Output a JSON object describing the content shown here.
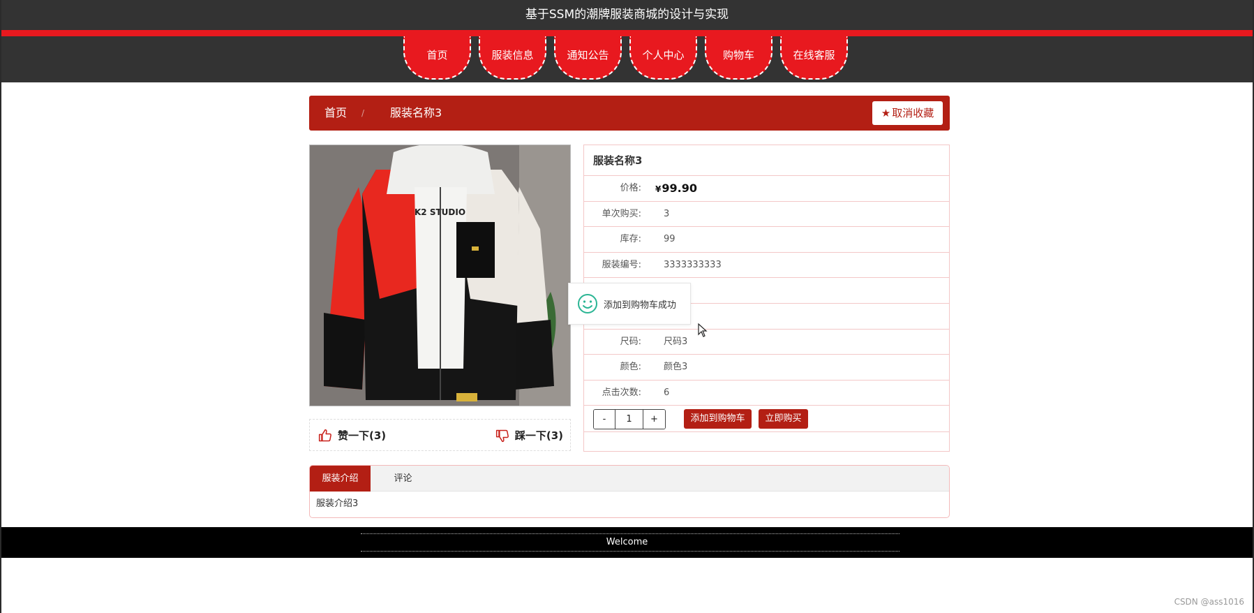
{
  "header": {
    "title": "基于SSM的潮牌服装商城的设计与实现"
  },
  "nav": {
    "items": [
      {
        "label": "首页"
      },
      {
        "label": "服装信息"
      },
      {
        "label": "通知公告"
      },
      {
        "label": "个人中心"
      },
      {
        "label": "购物车"
      },
      {
        "label": "在线客服"
      }
    ]
  },
  "breadcrumb": {
    "home": "首页",
    "separator": "/",
    "current": "服装名称3"
  },
  "favorite": {
    "label": "取消收藏"
  },
  "product": {
    "name": "服装名称3",
    "price_label": "价格:",
    "price_symbol": "¥",
    "price": "99.90",
    "rows": [
      {
        "label": "单次购买:",
        "value": "3"
      },
      {
        "label": "库存:",
        "value": "99"
      },
      {
        "label": "服装编号:",
        "value": "3333333333"
      },
      {
        "label": "",
        "value": ""
      },
      {
        "label": "",
        "value": ""
      },
      {
        "label": "尺码:",
        "value": "尺码3"
      },
      {
        "label": "颜色:",
        "value": "颜色3"
      },
      {
        "label": "点击次数:",
        "value": "6"
      }
    ],
    "image_text": "K2 STUDIO"
  },
  "quantity": {
    "minus": "-",
    "value": "1",
    "plus": "+"
  },
  "actions": {
    "add_to_cart": "添加到购物车",
    "buy_now": "立即购买"
  },
  "votes": {
    "like": "赞一下(3)",
    "dislike": "踩一下(3)"
  },
  "toast": {
    "message": "添加到购物车成功"
  },
  "tabs": {
    "items": [
      {
        "label": "服装介绍"
      },
      {
        "label": "评论"
      }
    ],
    "active_content": "服装介绍3"
  },
  "footer": {
    "text": "Welcome"
  },
  "watermark": "CSDN @ass1016",
  "colors": {
    "dark": "#333333",
    "accent_red": "#e8191f",
    "brand_red": "#b31f14"
  }
}
